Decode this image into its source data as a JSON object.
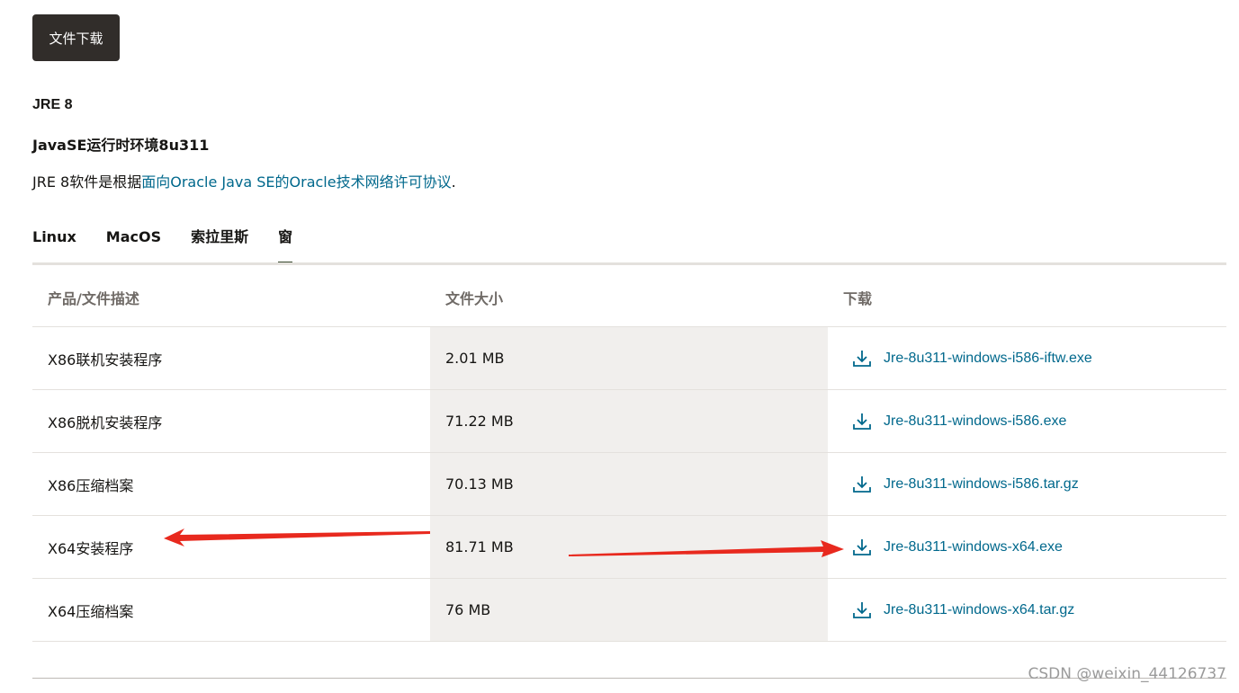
{
  "download_button": "文件下载",
  "product_title": "JRE 8",
  "product_subtitle": "JavaSE运行时环境8u311",
  "license": {
    "prefix": "JRE 8软件是根据",
    "link": "面向Oracle Java SE的Oracle技术网络许可协议",
    "suffix": "."
  },
  "tabs": [
    {
      "label": "Linux",
      "active": false
    },
    {
      "label": "MacOS",
      "active": false
    },
    {
      "label": "索拉里斯",
      "active": false
    },
    {
      "label": "窗",
      "active": true
    }
  ],
  "table": {
    "headers": [
      "产品/文件描述",
      "文件大小",
      "下载"
    ],
    "rows": [
      {
        "desc": "X86联机安装程序",
        "size": "2.01 MB",
        "file": "Jre-8u311-windows-i586-iftw.exe"
      },
      {
        "desc": "X86脱机安装程序",
        "size": "71.22 MB",
        "file": "Jre-8u311-windows-i586.exe"
      },
      {
        "desc": "X86压缩档案",
        "size": "70.13 MB",
        "file": "Jre-8u311-windows-i586.tar.gz"
      },
      {
        "desc": "X64安装程序",
        "size": "81.71 MB",
        "file": "Jre-8u311-windows-x64.exe"
      },
      {
        "desc": "X64压缩档案",
        "size": "76 MB",
        "file": "Jre-8u311-windows-x64.tar.gz"
      }
    ]
  },
  "watermark": "CSDN @weixin_44126737",
  "colors": {
    "link": "#00688c",
    "button_bg": "#312d2a",
    "arrow": "#e8291e",
    "size_col_bg": "#f1efed"
  }
}
